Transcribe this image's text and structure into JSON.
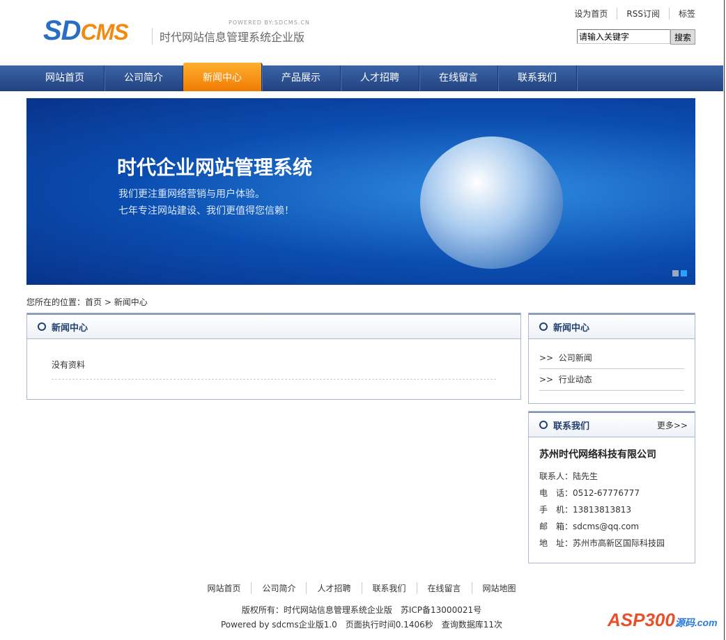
{
  "header": {
    "logo": "SD",
    "logo2": "CMS",
    "powered": "POWERED BY:SDCMS.CN",
    "slogan": "时代网站信息管理系统企业版",
    "toplinks": [
      "设为首页",
      "RSS订阅",
      "标签"
    ],
    "search_placeholder": "请输入关键字",
    "search_button": "搜索"
  },
  "nav": [
    "网站首页",
    "公司简介",
    "新闻中心",
    "产品展示",
    "人才招聘",
    "在线留言",
    "联系我们"
  ],
  "banner": {
    "title": "时代企业网站管理系统",
    "line1": "我们更注重网络营销与用户体验。",
    "line2": "七年专注网站建设、我们更值得您信赖！"
  },
  "breadcrumb": {
    "label": "您所在的位置：",
    "home": "首页",
    "sep": ">",
    "current": "新闻中心"
  },
  "main": {
    "title": "新闻中心",
    "empty": "没有资料"
  },
  "side_news": {
    "title": "新闻中心",
    "items": [
      "公司新闻",
      "行业动态"
    ]
  },
  "contact": {
    "title": "联系我们",
    "more": "更多>>",
    "company": "苏州时代网络科技有限公司",
    "lines": [
      "联系人：陆先生",
      "电　话：0512-67776777",
      "手　机：13813813813",
      "邮　箱：sdcms@qq.com",
      "地　址：苏州市高新区国际科技园"
    ]
  },
  "footer": {
    "links": [
      "网站首页",
      "公司简介",
      "人才招聘",
      "联系我们",
      "在线留言",
      "网站地图"
    ],
    "copyright": "版权所有：时代网站信息管理系统企业版　苏ICP备13000021号",
    "powered": "Powered by sdcms企业版1.0　页面执行时间0.1406秒　查询数据库11次"
  },
  "watermark": {
    "text": "ASP300",
    "sub": "源码.com"
  }
}
